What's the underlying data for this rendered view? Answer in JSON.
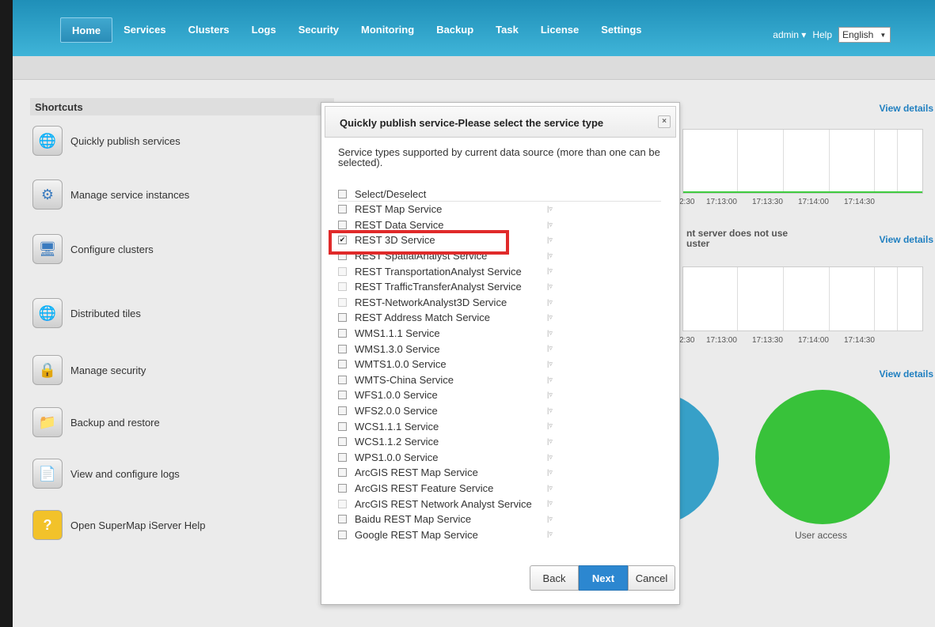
{
  "nav": {
    "items": [
      "Home",
      "Services",
      "Clusters",
      "Logs",
      "Security",
      "Monitoring",
      "Backup",
      "Task",
      "License",
      "Settings"
    ],
    "active_index": 0,
    "user": "admin",
    "help": "Help",
    "language": "English"
  },
  "shortcuts": {
    "title": "Shortcuts",
    "items": [
      {
        "label": "Quickly publish services",
        "icon": "globe-publish-icon"
      },
      {
        "label": "Manage service instances",
        "icon": "gear-window-icon"
      },
      {
        "label": "Configure clusters",
        "icon": "cluster-computers-icon"
      },
      {
        "label": "Distributed tiles",
        "icon": "globe-tiles-icon"
      },
      {
        "label": "Manage security",
        "icon": "lock-icon"
      },
      {
        "label": "Backup and restore",
        "icon": "backup-folder-icon"
      },
      {
        "label": "View and configure logs",
        "icon": "log-document-icon"
      },
      {
        "label": "Open SuperMap iServer Help",
        "icon": "help-icon"
      }
    ]
  },
  "right": {
    "view_details": "View details",
    "ticks": [
      "2:30",
      "17:13:00",
      "17:13:30",
      "17:14:00",
      "17:14:30"
    ],
    "cluster_note": "nt server does not use\nuster",
    "user_access": "User access"
  },
  "dialog": {
    "title": "Quickly publish service-Please select the service type",
    "close": "×",
    "description": "Service types supported by current data source (more than one can be selected).",
    "select_all": "Select/Deselect",
    "services": [
      {
        "label": "REST Map Service",
        "checked": false,
        "disabled": false
      },
      {
        "label": "REST Data Service",
        "checked": false,
        "disabled": false
      },
      {
        "label": "REST 3D Service",
        "checked": true,
        "disabled": false
      },
      {
        "label": "REST SpatialAnalyst Service",
        "checked": false,
        "disabled": false
      },
      {
        "label": "REST TransportationAnalyst Service",
        "checked": false,
        "disabled": true
      },
      {
        "label": "REST TrafficTransferAnalyst Service",
        "checked": false,
        "disabled": true
      },
      {
        "label": "REST-NetworkAnalyst3D Service",
        "checked": false,
        "disabled": true
      },
      {
        "label": "REST Address Match Service",
        "checked": false,
        "disabled": false
      },
      {
        "label": "WMS1.1.1 Service",
        "checked": false,
        "disabled": false
      },
      {
        "label": "WMS1.3.0 Service",
        "checked": false,
        "disabled": false
      },
      {
        "label": "WMTS1.0.0 Service",
        "checked": false,
        "disabled": false
      },
      {
        "label": "WMTS-China Service",
        "checked": false,
        "disabled": false
      },
      {
        "label": "WFS1.0.0 Service",
        "checked": false,
        "disabled": false
      },
      {
        "label": "WFS2.0.0 Service",
        "checked": false,
        "disabled": false
      },
      {
        "label": "WCS1.1.1 Service",
        "checked": false,
        "disabled": false
      },
      {
        "label": "WCS1.1.2 Service",
        "checked": false,
        "disabled": false
      },
      {
        "label": "WPS1.0.0 Service",
        "checked": false,
        "disabled": false
      },
      {
        "label": "ArcGIS REST Map Service",
        "checked": false,
        "disabled": false
      },
      {
        "label": "ArcGIS REST Feature Service",
        "checked": false,
        "disabled": false
      },
      {
        "label": "ArcGIS REST Network Analyst Service",
        "checked": false,
        "disabled": true
      },
      {
        "label": "Baidu REST Map Service",
        "checked": false,
        "disabled": false
      },
      {
        "label": "Google REST Map Service",
        "checked": false,
        "disabled": false
      }
    ],
    "buttons": {
      "back": "Back",
      "next": "Next",
      "cancel": "Cancel"
    }
  },
  "colors": {
    "accent": "#2c87d0",
    "highlight": "#e02a2a",
    "green": "#38c23a",
    "blue": "#37a0c8"
  }
}
